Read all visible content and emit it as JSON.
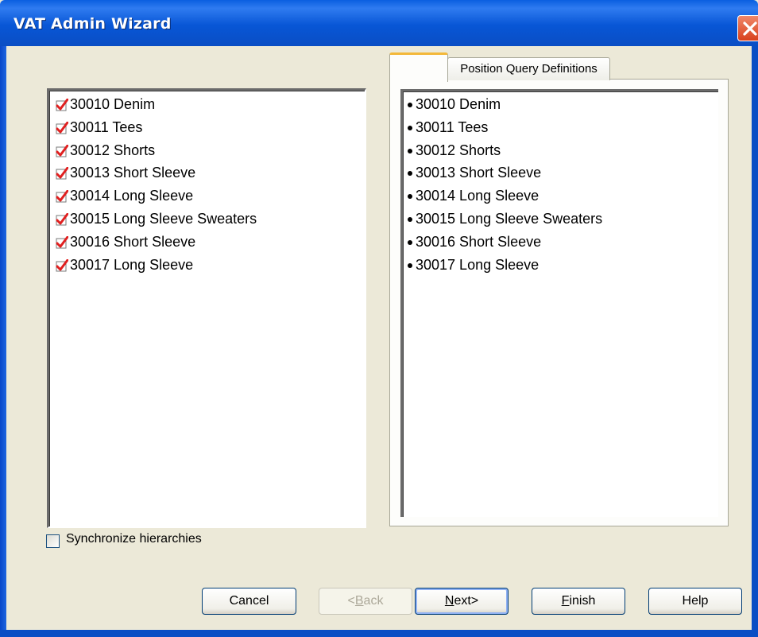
{
  "window": {
    "title": "VAT Admin Wizard"
  },
  "left_list": {
    "items": [
      {
        "label": "30010 Denim",
        "checked": true
      },
      {
        "label": "30011 Tees",
        "checked": true
      },
      {
        "label": "30012 Shorts",
        "checked": true
      },
      {
        "label": "30013 Short Sleeve",
        "checked": true
      },
      {
        "label": "30014 Long Sleeve",
        "checked": true
      },
      {
        "label": "30015 Long Sleeve Sweaters",
        "checked": true
      },
      {
        "label": "30016 Short Sleeve",
        "checked": true
      },
      {
        "label": "30017 Long Sleeve",
        "checked": true
      }
    ]
  },
  "tabs": [
    {
      "label": "",
      "active": true
    },
    {
      "label": "Position Query Definitions",
      "active": false
    }
  ],
  "right_list": {
    "items": [
      {
        "label": "30010 Denim"
      },
      {
        "label": "30011 Tees"
      },
      {
        "label": "30012 Shorts"
      },
      {
        "label": "30013 Short Sleeve"
      },
      {
        "label": "30014 Long Sleeve"
      },
      {
        "label": "30015 Long Sleeve Sweaters"
      },
      {
        "label": "30016 Short Sleeve"
      },
      {
        "label": "30017 Long Sleeve"
      }
    ]
  },
  "sync": {
    "label": "Synchronize hierarchies",
    "checked": false
  },
  "buttons": {
    "cancel": {
      "label": "Cancel",
      "enabled": true
    },
    "back": {
      "mnemonic": "<",
      "underline": "B",
      "rest": "ack",
      "enabled": false
    },
    "next": {
      "underline": "N",
      "rest": "ext>",
      "enabled": true
    },
    "finish": {
      "underline": "F",
      "rest": "inish",
      "enabled": true
    },
    "help": {
      "label": "Help",
      "enabled": true
    }
  },
  "colors": {
    "titlebar": "#0a5fe0",
    "check_mark": "#e02020",
    "face": "#ece9d8",
    "active_tab_accent": "#f3b83a"
  },
  "icons": {
    "close": "close-icon",
    "check": "red-check-icon",
    "bullet": "bullet-icon"
  }
}
